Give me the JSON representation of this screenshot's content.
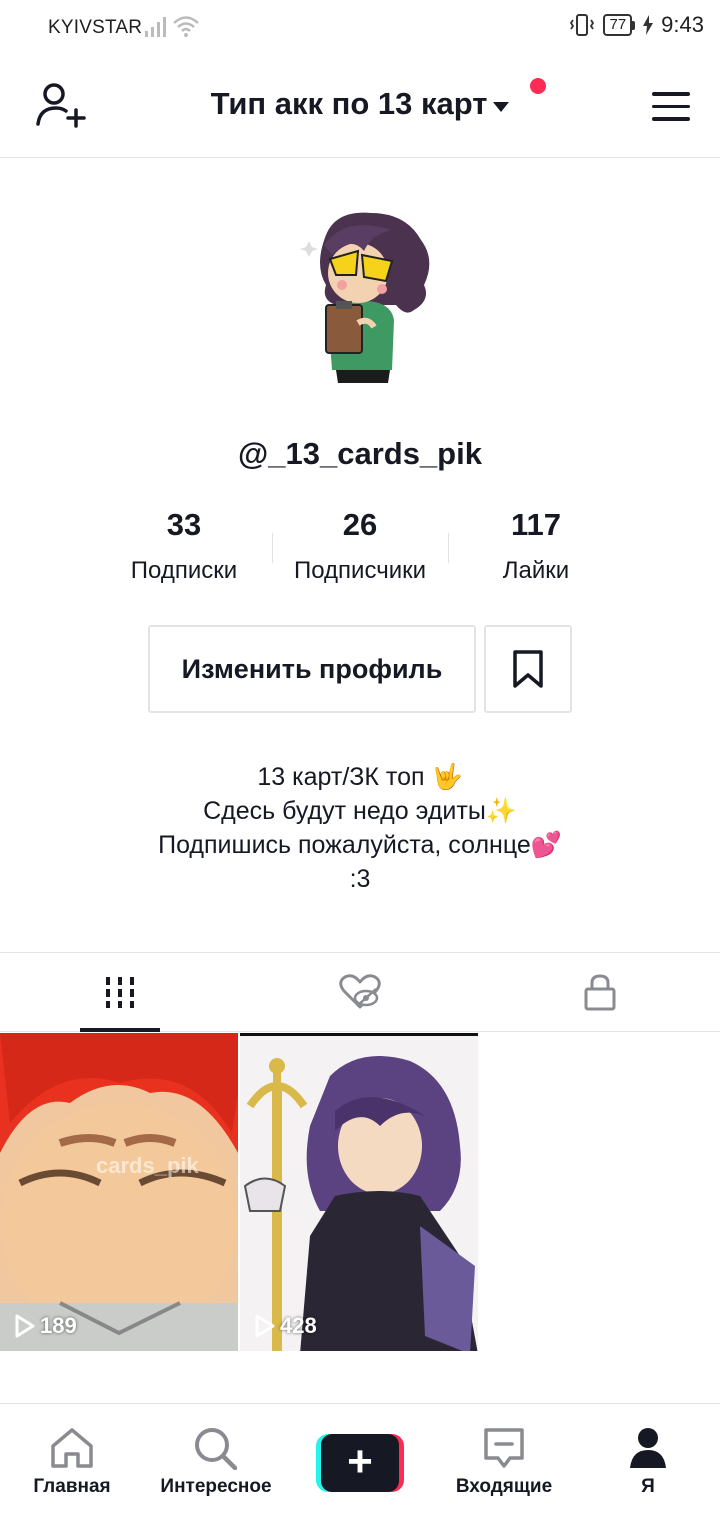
{
  "status_bar": {
    "carrier": "KYIVSTAR",
    "battery": "77",
    "time": "9:43"
  },
  "header": {
    "title": "Тип акк по 13 карт",
    "notification_dot_color": "#fe2c55"
  },
  "profile": {
    "username": "@_13_cards_pik",
    "stats": [
      {
        "value": "33",
        "label": "Подписки"
      },
      {
        "value": "26",
        "label": "Подписчики"
      },
      {
        "value": "117",
        "label": "Лайки"
      }
    ],
    "edit_button": "Изменить профиль",
    "bio": [
      "13 карт/ЗК топ 🤟",
      "Сдесь будут недо эдиты✨",
      "Подпишись пожалуйста, солнце💕",
      ":3"
    ]
  },
  "tabs": [
    {
      "icon": "videos-grid-icon",
      "active": true
    },
    {
      "icon": "liked-hidden-icon",
      "active": false
    },
    {
      "icon": "lock-icon",
      "active": false
    }
  ],
  "videos": [
    {
      "views": "189",
      "watermark": "cards_pik"
    },
    {
      "views": "428"
    }
  ],
  "bottom_nav": {
    "home": "Главная",
    "discover": "Интересное",
    "inbox": "Входящие",
    "me": "Я"
  },
  "colors": {
    "accent": "#fe2c55",
    "accent_cyan": "#25f4ee",
    "text": "#161823",
    "divider": "#e3e3e4"
  }
}
